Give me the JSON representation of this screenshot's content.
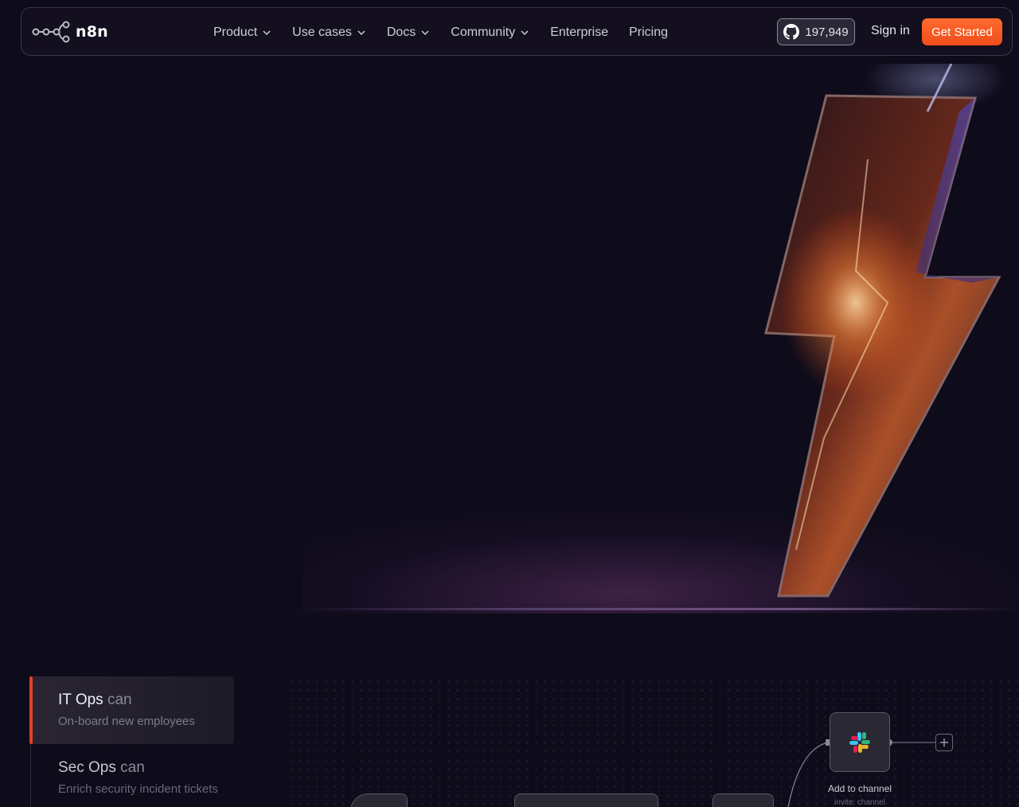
{
  "brand": {
    "name": "n8n"
  },
  "nav": {
    "items": [
      {
        "label": "Product",
        "dropdown": true
      },
      {
        "label": "Use cases",
        "dropdown": true
      },
      {
        "label": "Docs",
        "dropdown": true
      },
      {
        "label": "Community",
        "dropdown": true
      },
      {
        "label": "Enterprise",
        "dropdown": false
      },
      {
        "label": "Pricing",
        "dropdown": false
      }
    ],
    "github_stars": "197,949",
    "signin_label": "Sign in",
    "cta_label": "Get Started"
  },
  "use_cases": [
    {
      "team": "IT Ops",
      "verb": "can",
      "task": "On-board new employees",
      "active": true
    },
    {
      "team": "Sec Ops",
      "verb": "can",
      "task": "Enrich security incident tickets",
      "active": false
    }
  ],
  "workflow": {
    "node_label": "Add to channel",
    "node_sub": "invite: channel"
  },
  "colors": {
    "accent": "#f04e1c",
    "background": "#0e0b1a",
    "active_bar": "#e0412b"
  }
}
